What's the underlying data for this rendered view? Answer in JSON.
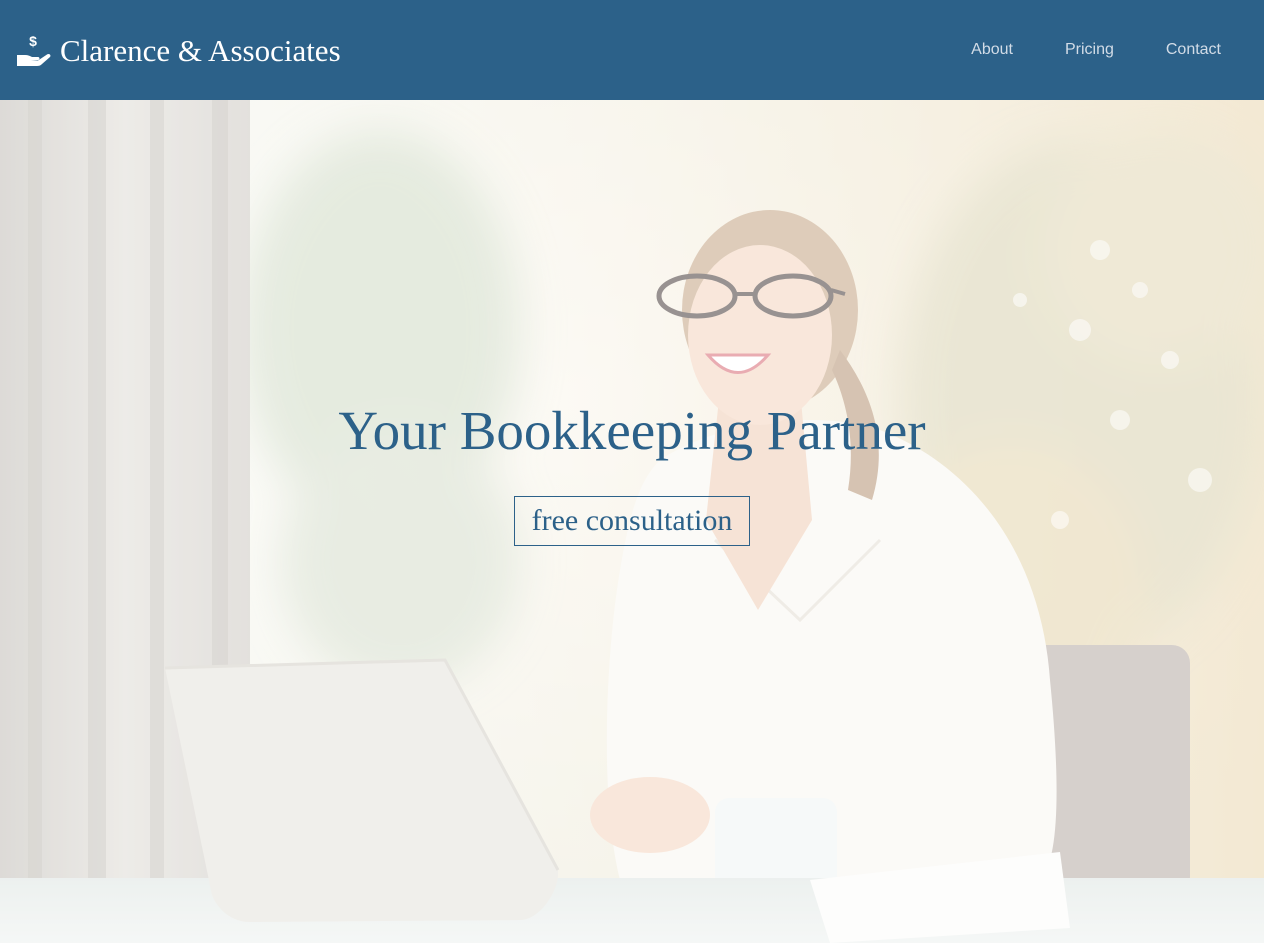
{
  "header": {
    "brand_name": "Clarence & Associates",
    "brand_icon": "hand-holding-dollar-icon",
    "nav": [
      {
        "label": "About"
      },
      {
        "label": "Pricing"
      },
      {
        "label": "Contact"
      }
    ]
  },
  "hero": {
    "title": "Your Bookkeeping Partner",
    "cta_label": "free consultation",
    "photo": "smiling woman in white blazer with glasses seated at desk with laptop"
  },
  "colors": {
    "brand_blue": "#2c6189",
    "nav_text": "#d2dce7",
    "hero_overlay": "#ffffff"
  }
}
